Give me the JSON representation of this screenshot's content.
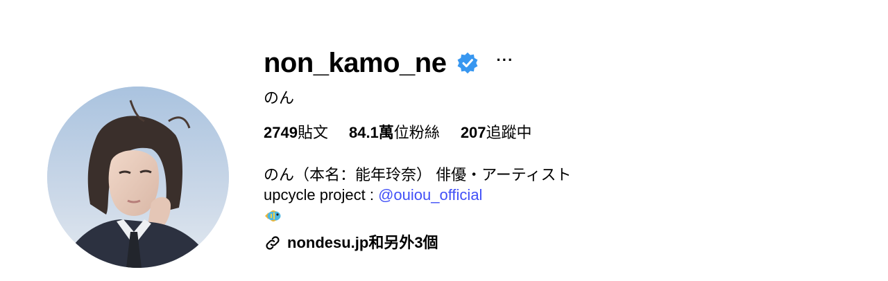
{
  "profile": {
    "username": "non_kamo_ne",
    "verified_icon": "verified-badge-icon",
    "more_label": "···",
    "full_name": "のん",
    "accent_color": "#4150f7",
    "verified_color": "#3897f0"
  },
  "stats": {
    "posts": {
      "value": "2749",
      "label": "貼文"
    },
    "followers": {
      "value": "84.1萬",
      "label": "位粉絲"
    },
    "following": {
      "value": "207",
      "label": "追蹤中"
    }
  },
  "bio": {
    "line1": "のん（本名：能年玲奈） 俳優・アーティスト",
    "line2_prefix": "upcycle project : ",
    "line2_mention": "@ouiou_official",
    "line3_icon": "tropical-fish-emoji"
  },
  "links": {
    "icon": "link-icon",
    "label": "nondesu.jp和另外3個"
  }
}
